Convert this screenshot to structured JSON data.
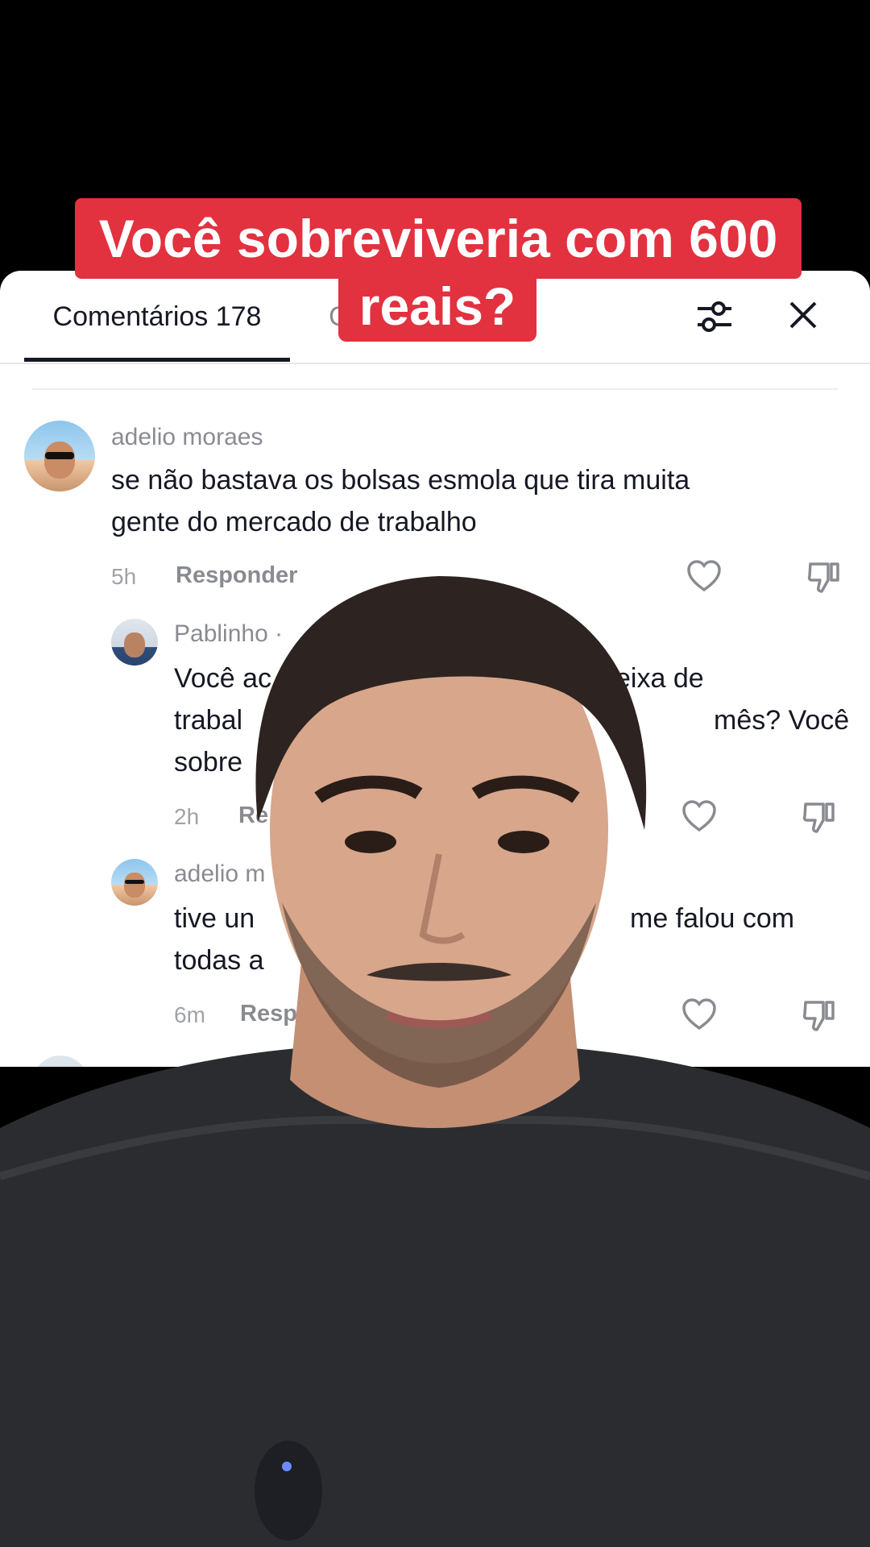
{
  "caption": {
    "line1": "Você sobreviveria com 600",
    "line2": "reais?"
  },
  "panel": {
    "tab_label": "Comentários 178",
    "other_tab_partial": "C",
    "filter_icon": "filter-sliders-icon",
    "close_icon": "close-icon"
  },
  "comments": [
    {
      "username": "adelio moraes",
      "lines": [
        "se não bastava os bolsas esmola que tira muita",
        "gente do mercado de trabalho"
      ],
      "time": "5h",
      "reply_label": "Responder"
    },
    {
      "username": "Pablinho ·",
      "lines": [
        "Você ac",
        "eixa de",
        "trabal",
        "mês? Você",
        "sobre"
      ],
      "time": "2h",
      "reply_label": "Re"
    },
    {
      "username": "adelio m",
      "lines": [
        "tive un",
        "me falou com",
        "todas a"
      ],
      "time": "6m",
      "reply_label": "Resp"
    }
  ],
  "colors": {
    "caption_bg": "#e2313f",
    "panel_bg": "#ffffff",
    "text": "#161823",
    "muted": "#8a8b91"
  }
}
